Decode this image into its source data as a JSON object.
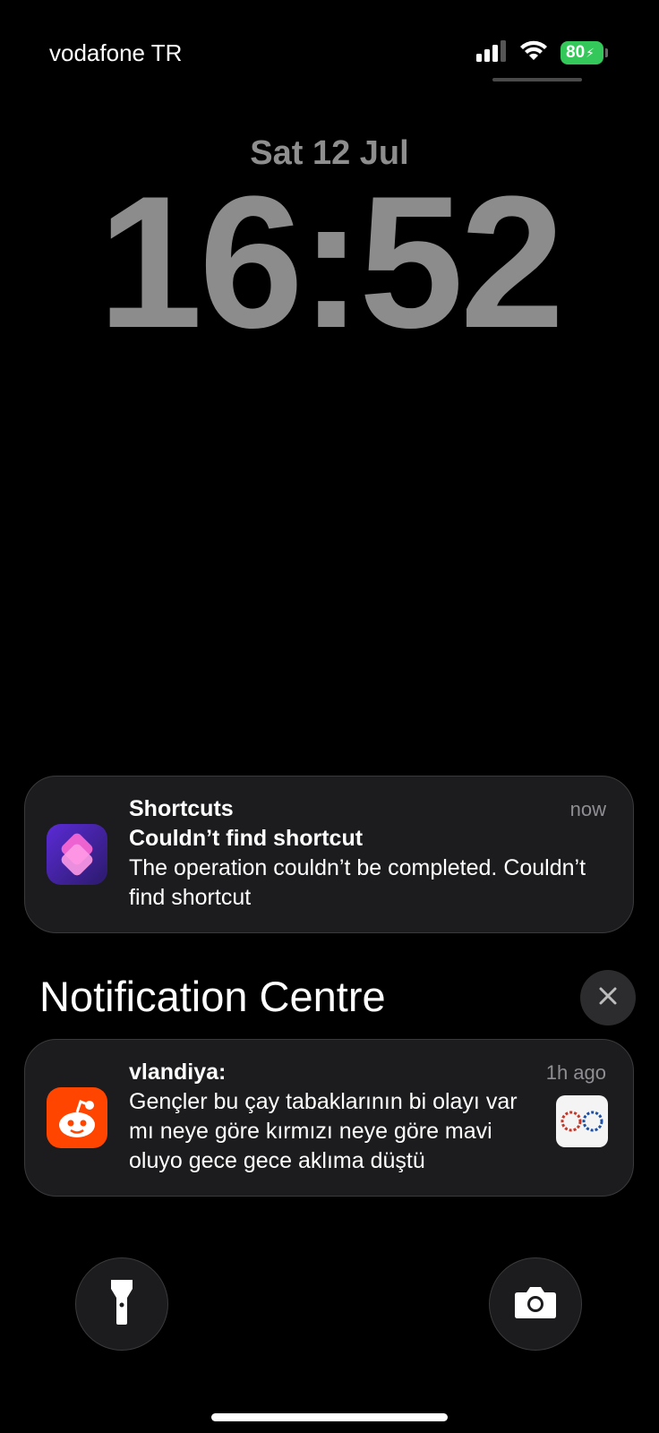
{
  "status_bar": {
    "carrier": "vodafone TR",
    "battery_percent": "80",
    "battery_color": "#34c759",
    "signal_icon": "cellular-signal-icon",
    "wifi_icon": "wifi-icon",
    "charging_icon": "bolt-icon"
  },
  "lock_screen": {
    "date": "Sat 12 Jul",
    "time": "16:52"
  },
  "notifications": [
    {
      "app": "Shortcuts",
      "time": "now",
      "title": "Couldn’t find shortcut",
      "body": "The operation couldn’t be completed. Couldn’t find shortcut",
      "icon": "shortcuts-app-icon"
    }
  ],
  "notification_centre": {
    "title": "Notification Centre",
    "close_icon": "close-icon",
    "items": [
      {
        "title": "vlandiya:",
        "time": "1h ago",
        "body": "Gençler bu çay tabaklarının bi olayı var mı neye göre kırmızı neye göre mavi oluyo gece gece aklıma düştü",
        "icon": "reddit-app-icon",
        "thumbnail": "image-thumbnail"
      }
    ]
  },
  "bottom_controls": {
    "left": "flashlight-icon",
    "right": "camera-icon"
  }
}
